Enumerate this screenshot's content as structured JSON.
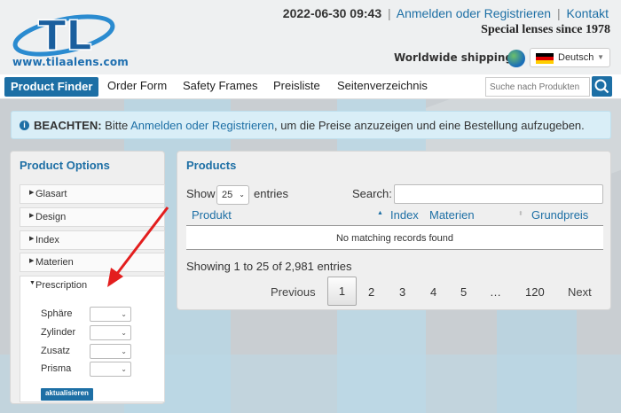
{
  "header": {
    "logo_text": "TL",
    "logo_url": "www.tilaalens.com",
    "datetime": "2022-06-30 09:43",
    "login_link": "Anmelden oder Registrieren",
    "contact_link": "Kontakt",
    "tagline": "Special lenses since 1978",
    "shipping": "Worldwide shipping",
    "language": "Deutsch",
    "icons": {
      "shipping": "globe-icon",
      "language": "german-flag-icon",
      "dropdown": "caret-down-icon"
    }
  },
  "nav": {
    "items": [
      "Product Finder",
      "Order Form",
      "Safety Frames",
      "Preisliste",
      "Seitenverzeichnis"
    ],
    "search_placeholder": "Suche nach Produkten",
    "search_icon": "search-icon",
    "active_color": "#1d6fa5"
  },
  "notice": {
    "icon": "info-icon",
    "label": "BEACHTEN:",
    "pre": " Bitte ",
    "link": "Anmelden oder Registrieren",
    "post": ", um die Preise anzuzeigen und eine Bestellung aufzugeben."
  },
  "product_options": {
    "title": "Product Options",
    "sections": [
      "Glasart",
      "Design",
      "Index",
      "Materien",
      "Prescription"
    ],
    "open_section": "Prescription",
    "fields": [
      "Sphäre",
      "Zylinder",
      "Zusatz",
      "Prisma"
    ],
    "update_button": "aktualisieren"
  },
  "products": {
    "title": "Products",
    "show_label": "Show",
    "page_size": "25",
    "entries_label": "entries",
    "search_label": "Search:",
    "columns": [
      "Produkt",
      "Index",
      "Materien",
      "Grundpreis"
    ],
    "empty_message": "No matching records found",
    "info": "Showing 1 to 25 of 2,981 entries",
    "pagination": {
      "prev": "Previous",
      "pages": [
        "1",
        "2",
        "3",
        "4",
        "5",
        "…",
        "120"
      ],
      "current": "1",
      "next": "Next"
    }
  },
  "colors": {
    "brand": "#1d6fa5",
    "notice_bg": "#d9eef7",
    "arrow": "#e31e1e"
  }
}
